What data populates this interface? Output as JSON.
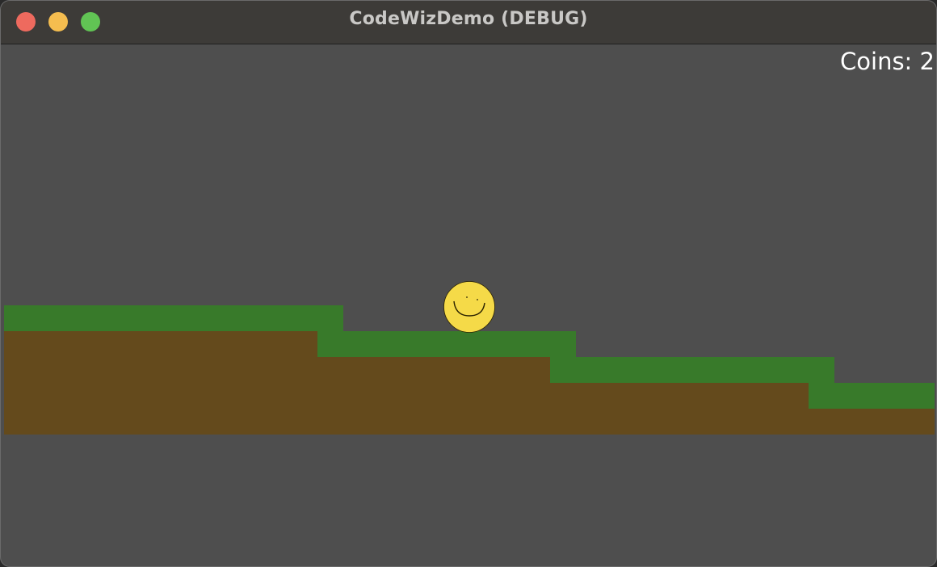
{
  "window": {
    "title": "CodeWizDemo (DEBUG)",
    "controls": [
      "close",
      "minimize",
      "maximize"
    ]
  },
  "hud": {
    "coins_text": "Coins: 2"
  },
  "player": {
    "icon": "smiley-face-icon",
    "color": "#f5da48"
  },
  "colors": {
    "background": "#4e4e4e",
    "grass": "#387a2a",
    "dirt": "#644a1c",
    "close": "#ee6a5e",
    "minimize": "#f5bd4f",
    "maximize": "#61c454"
  }
}
